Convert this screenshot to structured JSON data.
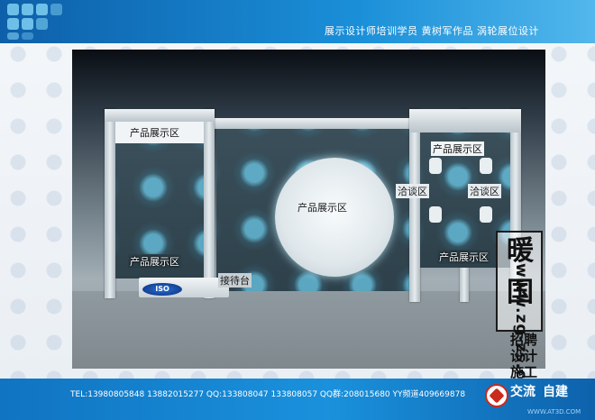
{
  "header": {
    "title": "展示设计师培训学员 黄树军作品  涡轮展位设计"
  },
  "render": {
    "zones": {
      "left_top": "产品展示区",
      "left_bottom": "产品展示区",
      "center": "产品展示区",
      "reception": "接待台",
      "meeting_left": "洽谈区",
      "meeting_right": "洽谈区",
      "right_top": "产品展示区",
      "right_bottom": "产品展示区"
    },
    "badge": "ISO"
  },
  "watermark": {
    "seal_char_top": "暖",
    "seal_char_bottom": "国",
    "line1": "招聘",
    "line2": "设计",
    "line3": "施工",
    "line4": "交流",
    "line5": "自建",
    "url": "www.zg-zs.com"
  },
  "footer": {
    "contact": "TEL:13980805848  13882015277 QQ:133808047  133808057  QQ群:208015680  YY频道409669878",
    "site": "WWW.AT3D.COM"
  }
}
